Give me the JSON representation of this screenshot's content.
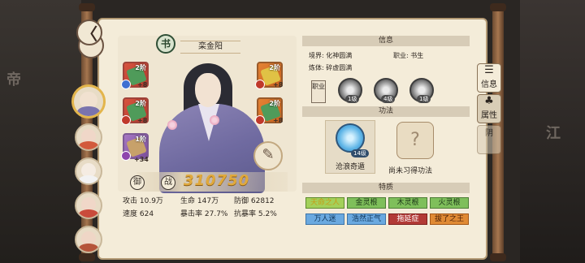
{
  "background": {
    "left_glyph": "帝",
    "right_glyph": "江"
  },
  "back_button": {
    "icon": "back-arrow-icon",
    "label": "〈"
  },
  "roster": [
    {
      "name": "栾金阳",
      "active": true,
      "hair": "#2b2b33",
      "robe": "#7a73ad"
    },
    {
      "name": "",
      "active": false,
      "hair": "#8a2a22",
      "robe": "#d25a3c"
    },
    {
      "name": "",
      "active": false,
      "hair": "#1f1f1f",
      "robe": "#f2f2f2"
    },
    {
      "name": "",
      "active": false,
      "hair": "#5a2a20",
      "robe": "#c94b3b"
    },
    {
      "name": "",
      "active": false,
      "hair": "#4a2a22",
      "robe": "#b5543a"
    }
  ],
  "character": {
    "class_seal": "书",
    "name": "栾金阳",
    "combat_power_label": "战",
    "combat_power_icon": "御",
    "combat_power": "310750",
    "seal_icon": "✎"
  },
  "equipment_slots": [
    {
      "level": "2阶",
      "bonus": "+8",
      "color": "red",
      "badge": "shield-badge"
    },
    {
      "level": "2阶",
      "bonus": "+8",
      "color": "red",
      "badge": "flame-badge"
    },
    {
      "level": "1阶",
      "bonus": "+34",
      "color": "red",
      "badge": "lotus-badge"
    },
    {
      "level": "2阶",
      "bonus": "+8",
      "color": "orange",
      "badge": "flame-badge"
    },
    {
      "level": "2阶",
      "bonus": "+8",
      "color": "orange",
      "badge": "flame-badge"
    }
  ],
  "stats": [
    {
      "label": "攻击",
      "value": "10.9万"
    },
    {
      "label": "生命",
      "value": "147万"
    },
    {
      "label": "防御",
      "value": "62812"
    },
    {
      "label": "速度",
      "value": "624"
    },
    {
      "label": "暴击率",
      "value": "27.7%"
    },
    {
      "label": "抗暴率",
      "value": "5.2%"
    }
  ],
  "info": {
    "header": "信息",
    "realm_label": "境界:",
    "realm_value": "化神圆满",
    "job_label": "职业:",
    "job_value": "书生",
    "refine_label": "炼体:",
    "refine_value": "碎虚圆满",
    "job_tag": "职业",
    "gear": [
      {
        "level": "1级",
        "icon": "brush-icon"
      },
      {
        "level": "4级",
        "icon": "inkstone-icon"
      },
      {
        "level": "1级",
        "icon": "spider-icon"
      }
    ]
  },
  "skills": {
    "header": "功法",
    "learned": {
      "name": "沧浪奇遁",
      "level": "14级",
      "icon": "wave-orb-icon"
    },
    "empty_text": "尚未习得功法",
    "empty_icon": "?"
  },
  "traits": {
    "header": "特质",
    "items": [
      {
        "label": "天命之人",
        "tone": "yellow"
      },
      {
        "label": "金灵根",
        "tone": "green"
      },
      {
        "label": "木灵根",
        "tone": "green"
      },
      {
        "label": "火灵根",
        "tone": "green"
      },
      {
        "label": "万人迷",
        "tone": "blue"
      },
      {
        "label": "浩然正气",
        "tone": "blue"
      },
      {
        "label": "拖延症",
        "tone": "red"
      },
      {
        "label": "拔了之王",
        "tone": "orange"
      }
    ]
  },
  "tabs": [
    {
      "label": "信息",
      "icon": "scroll-icon",
      "state": "active"
    },
    {
      "label": "属性",
      "icon": "ghost-icon",
      "state": "inactive"
    },
    {
      "label": "阴",
      "icon": "",
      "state": "ghost"
    }
  ]
}
